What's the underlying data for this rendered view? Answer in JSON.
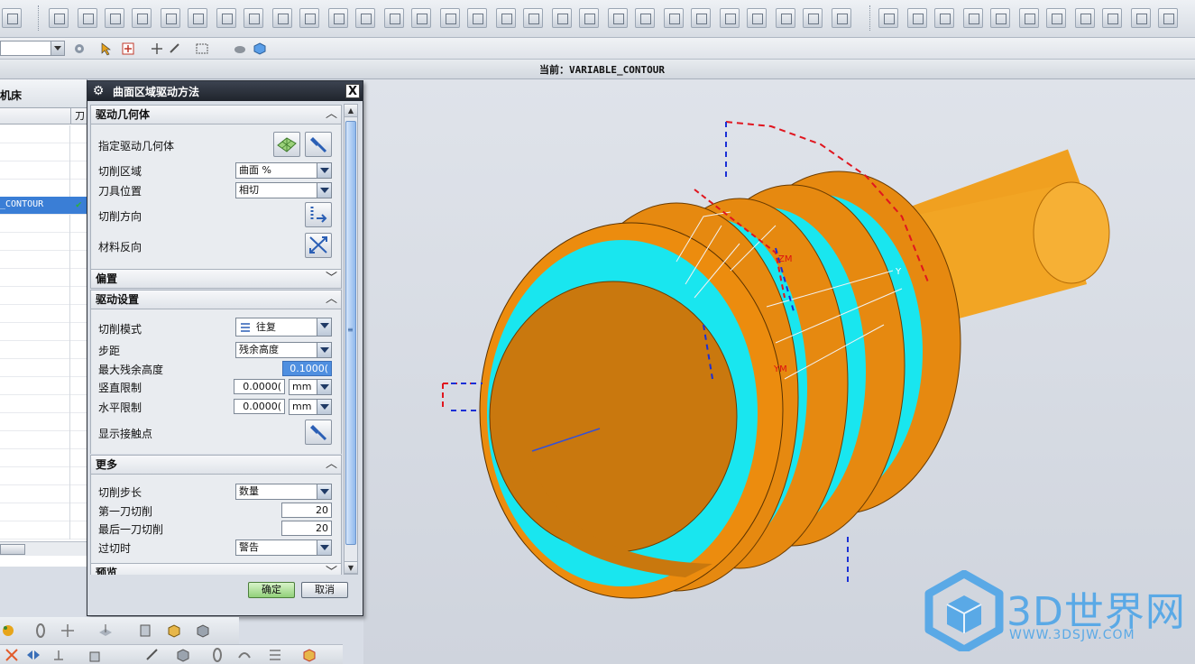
{
  "status_bar": {
    "current_prefix": "当前：",
    "current_operation": "VARIABLE_CONTOUR",
    "current_text": "当前：VARIABLE_CONTOUR"
  },
  "navigator": {
    "header_title": "机床",
    "column_tool": "刀",
    "selected_item": "_CONTOUR"
  },
  "dialog": {
    "title": "曲面区域驱动方法",
    "close_label": "X",
    "sections": {
      "drive_geometry": {
        "title": "驱动几何体",
        "specify_label": "指定驱动几何体",
        "cut_area_label": "切削区域",
        "cut_area_value": "曲面 %",
        "tool_position_label": "刀具位置",
        "tool_position_value": "相切",
        "cut_direction_label": "切削方向",
        "material_reverse_label": "材料反向"
      },
      "offset": {
        "title": "偏置"
      },
      "drive_settings": {
        "title": "驱动设置",
        "cut_mode_label": "切削模式",
        "cut_mode_value": "往复",
        "stepover_label": "步距",
        "stepover_value": "残余高度",
        "max_scallop_label": "最大残余高度",
        "max_scallop_value": "0.1000(",
        "vertical_limit_label": "竖直限制",
        "vertical_limit_value": "0.0000(",
        "vertical_limit_unit": "mm",
        "horizontal_limit_label": "水平限制",
        "horizontal_limit_value": "0.0000(",
        "horizontal_limit_unit": "mm",
        "show_contact_label": "显示接触点"
      },
      "more": {
        "title": "更多",
        "cut_step_label": "切削步长",
        "cut_step_value": "数量",
        "first_cut_label": "第一刀切削",
        "first_cut_value": "20",
        "last_cut_label": "最后一刀切削",
        "last_cut_value": "20",
        "overcut_label": "过切时",
        "overcut_value": "警告"
      },
      "preview": {
        "title": "预览"
      }
    },
    "ok_label": "确定",
    "cancel_label": "取消"
  },
  "viewport": {
    "axis_zm": "ZM",
    "axis_ym": "YM",
    "axis_y": "Y"
  },
  "watermark": {
    "text": "3D世界网",
    "url": "WWW.3DSJW.COM"
  },
  "colors": {
    "part_orange": "#e88a0c",
    "part_face": "#c9780e",
    "toolpath_cyan": "#19e6ef",
    "accent_blue": "#3a7ed6"
  }
}
